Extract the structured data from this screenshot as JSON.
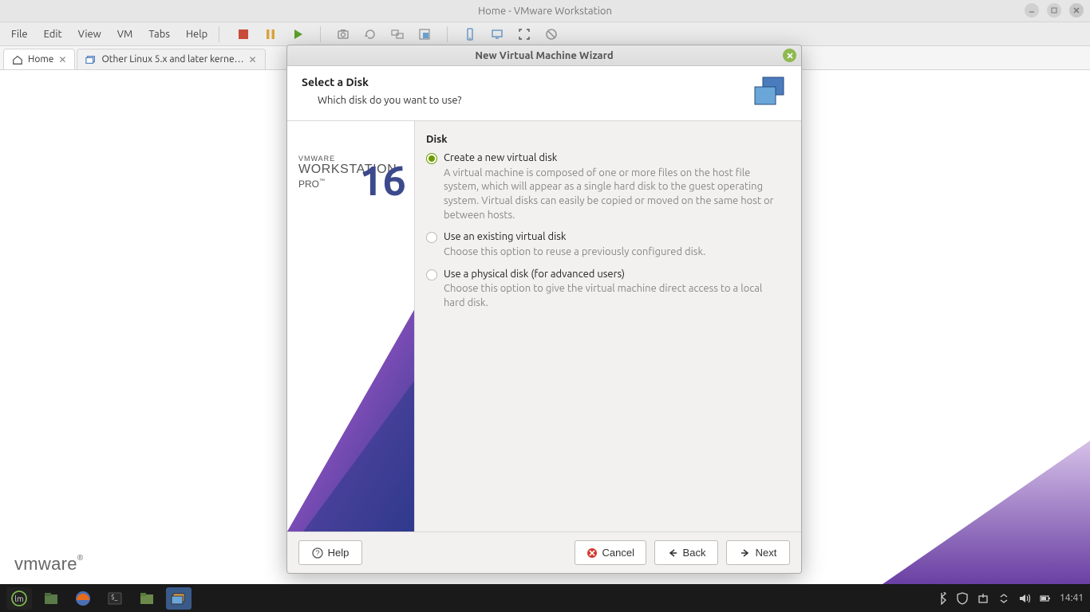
{
  "window": {
    "title": "Home - VMware Workstation"
  },
  "menu": {
    "file": "File",
    "edit": "Edit",
    "view": "View",
    "vm": "VM",
    "tabs": "Tabs",
    "help": "Help"
  },
  "tabs": {
    "home": {
      "label": "Home"
    },
    "other": {
      "label": "Other Linux 5.x and later kerne…"
    }
  },
  "mainbrand": {
    "vmware": "vmware",
    "reg": "®"
  },
  "dialog": {
    "title": "New Virtual Machine Wizard",
    "heading": "Select a Disk",
    "subheading": "Which disk do you want to use?",
    "sidebar": {
      "l1": "VMWARE",
      "l2": "WORKSTATION",
      "l3": "PRO",
      "tm": "™",
      "num": "16"
    },
    "options_caption": "Disk",
    "opt1": {
      "label": "Create a new virtual disk",
      "desc": "A virtual machine is composed of one or more files on the host file system, which will appear as a single hard disk to the guest operating system. Virtual disks can easily be copied or moved on the same host or between hosts."
    },
    "opt2": {
      "label": "Use an existing virtual disk",
      "desc": "Choose this option to reuse a previously configured disk."
    },
    "opt3": {
      "label": "Use a physical disk (for advanced users)",
      "desc": "Choose this option to give the virtual machine direct access to a local hard disk."
    },
    "buttons": {
      "help": "Help",
      "cancel": "Cancel",
      "back": "Back",
      "next": "Next"
    }
  },
  "taskbar": {
    "time": "14:41"
  }
}
